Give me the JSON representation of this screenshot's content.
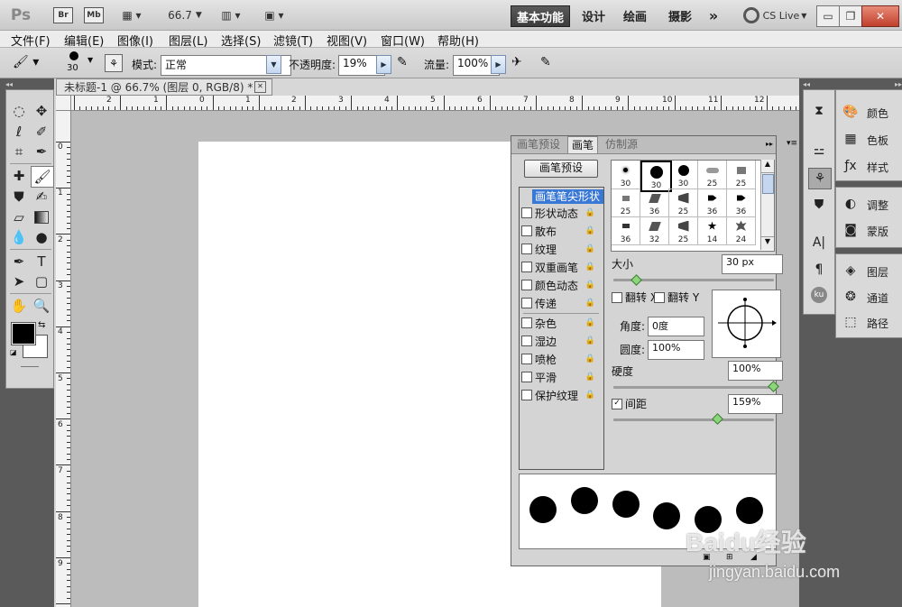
{
  "app": {
    "logo": "Ps",
    "bridge_label": "Br",
    "mini_bridge_label": "Mb",
    "zoom": "66.7",
    "workspaces": [
      "基本功能",
      "设计",
      "绘画",
      "摄影"
    ],
    "more": "»",
    "cs_live": "CS Live"
  },
  "menu": [
    "文件(F)",
    "编辑(E)",
    "图像(I)",
    "图层(L)",
    "选择(S)",
    "滤镜(T)",
    "视图(V)",
    "窗口(W)",
    "帮助(H)"
  ],
  "options": {
    "brush_size": "30",
    "mode_label": "模式:",
    "mode_value": "正常",
    "opacity_label": "不透明度:",
    "opacity_value": "19%",
    "flow_label": "流量:",
    "flow_value": "100%"
  },
  "document": {
    "tab_title": "未标题-1 @ 66.7% (图层 0, RGB/8) *",
    "hruler_labels": [
      "2",
      "1",
      "0",
      "1",
      "2",
      "3",
      "4",
      "5",
      "6",
      "7",
      "8",
      "9",
      "10",
      "11",
      "12"
    ],
    "vruler_labels": [
      "0",
      "1",
      "2",
      "3",
      "4",
      "5",
      "6",
      "7",
      "8",
      "9"
    ]
  },
  "right_panels": {
    "group1": [
      "颜色",
      "色板",
      "样式"
    ],
    "group2": [
      "调整",
      "蒙版"
    ],
    "group3": [
      "图层",
      "通道",
      "路径"
    ]
  },
  "brush_panel": {
    "tabs": [
      "画笔预设",
      "画笔",
      "仿制源"
    ],
    "preset_button": "画笔预设",
    "tip_shape_label": "画笔笔尖形状",
    "options": [
      "形状动态",
      "散布",
      "纹理",
      "双重画笔",
      "颜色动态",
      "传递",
      "杂色",
      "湿边",
      "喷枪",
      "平滑",
      "保护纹理"
    ],
    "tip_sizes": [
      "30",
      "30",
      "30",
      "25",
      "25",
      "25",
      "36",
      "25",
      "36",
      "36",
      "36",
      "32",
      "25",
      "14",
      "24"
    ],
    "size_label": "大小",
    "size_value": "30 px",
    "flip_x": "翻转 X",
    "flip_y": "翻转 Y",
    "angle_label": "角度:",
    "angle_value": "0度",
    "roundness_label": "圆度:",
    "roundness_value": "100%",
    "hardness_label": "硬度",
    "hardness_value": "100%",
    "spacing_label": "间距",
    "spacing_value": "159%"
  },
  "watermark": {
    "text": "Baidu经验",
    "url": "jingyan.baidu.com"
  },
  "colors": {
    "foreground": "#000000",
    "background": "#ffffff",
    "workspace_active": "#444444"
  }
}
